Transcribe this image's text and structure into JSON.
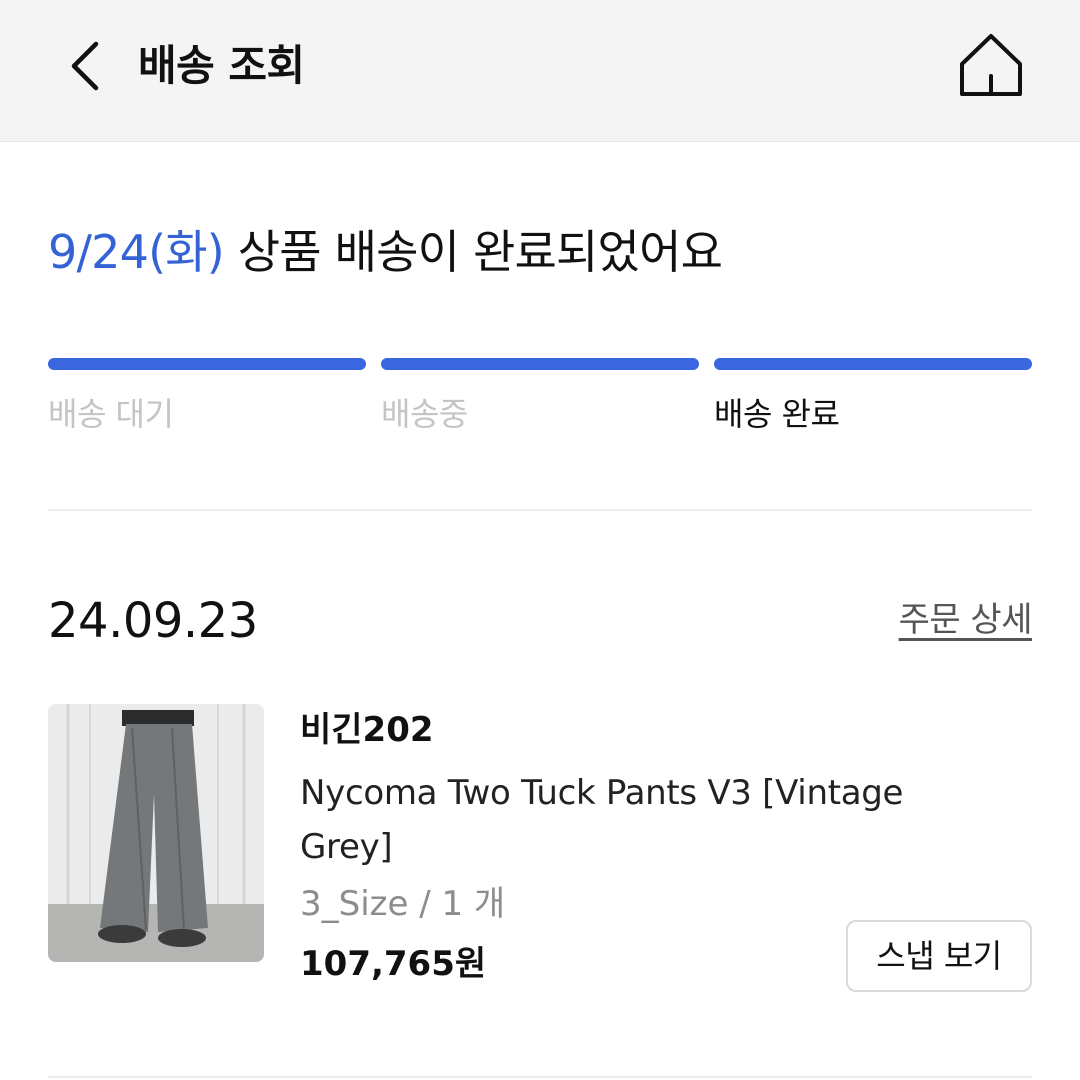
{
  "header": {
    "back_icon": "chevron-left-icon",
    "title": "배송 조회",
    "home_icon": "home-icon"
  },
  "status": {
    "date": "9/24(화)",
    "message": "상품 배송이 완료되었어요",
    "date_color": "#3563d6"
  },
  "progress": {
    "bar_color": "#3a67e0",
    "steps": [
      {
        "label": "배송 대기",
        "state": "inactive"
      },
      {
        "label": "배송중",
        "state": "inactive"
      },
      {
        "label": "배송 완료",
        "state": "active"
      }
    ]
  },
  "order": {
    "date": "24.09.23",
    "detail_link": "주문 상세",
    "item": {
      "brand": "비긴202",
      "name": "Nycoma Two Tuck Pants V3 [Vintage Grey]",
      "option": "3_Size / 1 개",
      "price": "107,765원",
      "snap_button": "스냅 보기"
    }
  }
}
